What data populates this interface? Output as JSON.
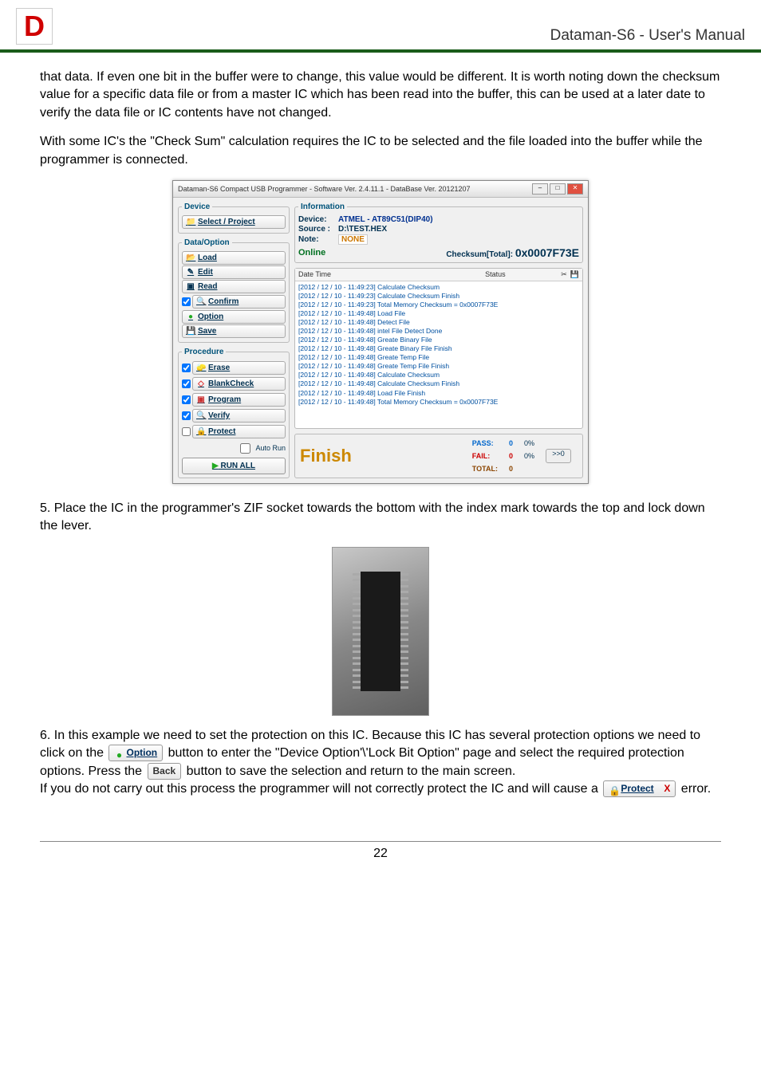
{
  "header": {
    "title": "Dataman-S6 - User's Manual"
  },
  "intro_para1": "that data. If even one bit in the buffer were to change, this value would be different. It is worth noting down the checksum value for a specific data file or from a master IC which has been read into the buffer, this can be used at a later date to verify the data file or IC contents have not changed.",
  "intro_para2": "With some IC's the \"Check Sum\" calculation requires the IC to be selected and the file loaded into the buffer while the programmer is connected.",
  "app": {
    "title": "Dataman-S6 Compact USB Programmer - Software Ver. 2.4.11.1 - DataBase Ver. 20121207",
    "groups": {
      "device": "Device",
      "data_option": "Data/Option",
      "procedure": "Procedure",
      "information": "Information"
    },
    "buttons": {
      "select_project": "Select / Project",
      "load": "Load",
      "edit": "Edit",
      "read": "Read",
      "confirm": "Confirm",
      "option": "Option",
      "save": "Save",
      "erase": "Erase",
      "blankcheck": "BlankCheck",
      "program": "Program",
      "verify": "Verify",
      "protect": "Protect",
      "auto_run": "Auto Run",
      "run_all": "RUN ALL"
    },
    "info": {
      "device_label": "Device:",
      "device_value": "ATMEL - AT89C51(DIP40)",
      "source_label": "Source :",
      "source_value": "D:\\TEST.HEX",
      "note_label": "Note:",
      "note_value": "NONE",
      "online": "Online",
      "checksum_label": "Checksum[Total]:",
      "checksum_value": "0x0007F73E"
    },
    "log_header": {
      "datetime": "Date Time",
      "status": "Status"
    },
    "log": [
      "[2012 / 12 / 10 - 11:49:23] Calculate Checksum",
      "[2012 / 12 / 10 - 11:49:23] Calculate Checksum Finish",
      "[2012 / 12 / 10 - 11:49:23] Total Memory Checksum = 0x0007F73E",
      "[2012 / 12 / 10 - 11:49:48] Load File",
      "[2012 / 12 / 10 - 11:49:48] Detect File",
      "[2012 / 12 / 10 - 11:49:48] intel File Detect Done",
      "[2012 / 12 / 10 - 11:49:48] Greate Binary File",
      "[2012 / 12 / 10 - 11:49:48] Greate Binary File Finish",
      "[2012 / 12 / 10 - 11:49:48] Greate Temp File",
      "[2012 / 12 / 10 - 11:49:48] Greate Temp File Finish",
      "[2012 / 12 / 10 - 11:49:48] Calculate Checksum",
      "[2012 / 12 / 10 - 11:49:48] Calculate Checksum Finish",
      "[2012 / 12 / 10 - 11:49:48] Load File Finish",
      "[2012 / 12 / 10 - 11:49:48] Total Memory Checksum = 0x0007F73E"
    ],
    "status": {
      "finish": "Finish",
      "pass_label": "PASS:",
      "pass_value": "0",
      "pass_pct": "0%",
      "fail_label": "FAIL:",
      "fail_value": "0",
      "fail_pct": "0%",
      "total_label": "TOTAL:",
      "total_value": "0",
      "reset_btn": ">>0"
    }
  },
  "item5_text": "5.  Place the IC in the programmer's ZIF socket towards the bottom with the index mark towards the top and lock down the lever.",
  "item6": {
    "line1a": "6.  In this example we need to set the protection on this IC. Because this IC has several protection options we need to click on the ",
    "option_btn": "Option",
    "line1b": " button to enter the \"Device Option'\\'Lock Bit Option\" page and select the required protection options. Press the ",
    "back_btn": "Back",
    "line1c": " button to save the selection and return to the main screen.",
    "line2a": "If you do not carry out this process the programmer will not correctly protect the  IC and will cause a ",
    "protect_btn": "Protect",
    "protect_x": "X",
    "line2b": " error."
  },
  "footer_page": "22"
}
